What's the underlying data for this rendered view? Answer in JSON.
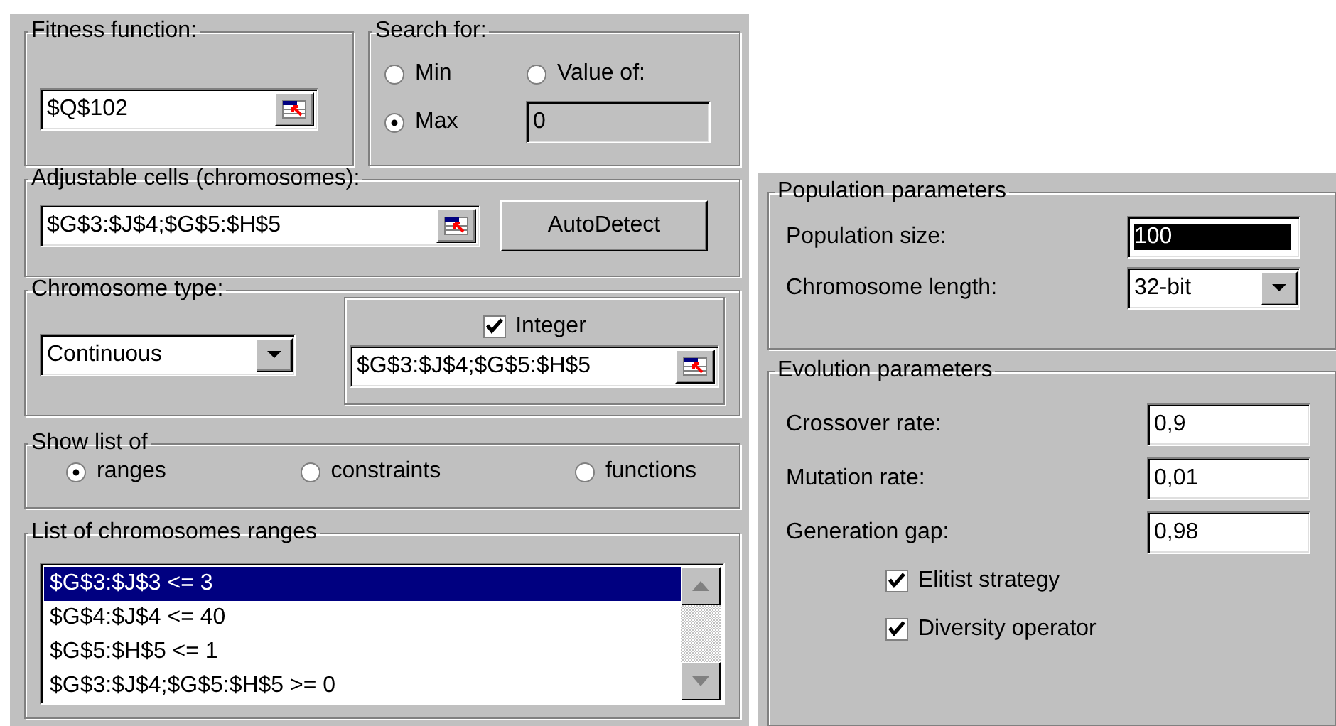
{
  "fitness_function": {
    "label": "Fitness function:",
    "value": "$Q$102"
  },
  "search_for": {
    "label": "Search  for:",
    "options": [
      {
        "label": "Min",
        "selected": false
      },
      {
        "label": "Value of:",
        "selected": false
      },
      {
        "label": "Max",
        "selected": true
      }
    ],
    "value_of": {
      "value": "0",
      "disabled": true
    }
  },
  "adjustable_cells": {
    "label": "Adjustable cells (chromosomes):",
    "value": "$G$3:$J$4;$G$5:$H$5",
    "button": "AutoDetect"
  },
  "chromosome_type": {
    "label": "Chromosome type:",
    "value": "Continuous",
    "integer": {
      "label": "Integer",
      "checked": true,
      "value": "$G$3:$J$4;$G$5:$H$5"
    }
  },
  "show_list_of": {
    "label": "Show list of",
    "options": [
      {
        "label": "ranges",
        "selected": true
      },
      {
        "label": "constraints",
        "selected": false
      },
      {
        "label": "functions",
        "selected": false
      }
    ]
  },
  "ranges_list": {
    "label": "List of chromosomes ranges",
    "items": [
      {
        "text": "$G$3:$J$3 <= 3",
        "selected": true
      },
      {
        "text": "$G$4:$J$4 <= 40",
        "selected": false
      },
      {
        "text": "$G$5:$H$5 <= 1",
        "selected": false
      },
      {
        "text": "$G$3:$J$4;$G$5:$H$5 >= 0",
        "selected": false
      }
    ]
  },
  "population_parameters": {
    "label": "Population parameters",
    "population_size": {
      "label": "Population size:",
      "value": "100",
      "selected": true
    },
    "chromosome_length": {
      "label": "Chromosome length:",
      "value": "32-bit"
    }
  },
  "evolution_parameters": {
    "label": "Evolution parameters",
    "fields": [
      {
        "label": "Crossover rate:",
        "value": "0,9"
      },
      {
        "label": "Mutation rate:",
        "value": "0,01"
      },
      {
        "label": "Generation gap:",
        "value": "0,98"
      }
    ],
    "checkboxes": [
      {
        "label": "Elitist strategy",
        "checked": true
      },
      {
        "label": "Diversity operator",
        "checked": true
      }
    ]
  }
}
